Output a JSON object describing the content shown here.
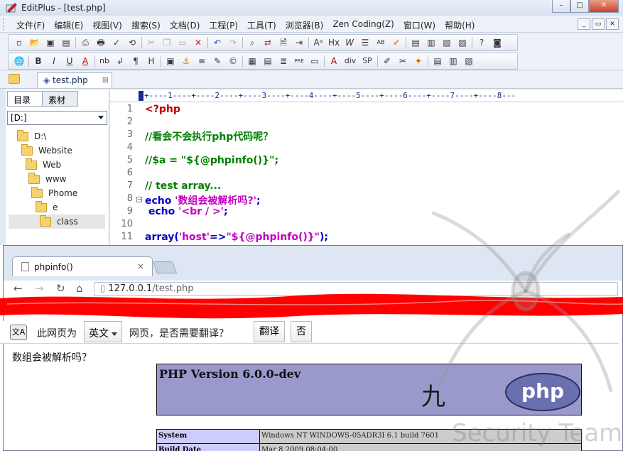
{
  "editplus": {
    "title": "EditPlus - [test.php]",
    "window_buttons": [
      "–",
      "□",
      "✕"
    ],
    "menu": [
      "文件(F)",
      "编辑(E)",
      "视图(V)",
      "搜索(S)",
      "文档(D)",
      "工程(P)",
      "工具(T)",
      "浏览器(B)",
      "Zen Coding(Z)",
      "窗口(W)",
      "帮助(H)"
    ],
    "mdi_buttons": [
      "_",
      "▭",
      "✕"
    ],
    "toolbar1": [
      "new",
      "open",
      "save",
      "save-all",
      "|",
      "print-preview",
      "print",
      "spellcheck",
      "browser-preview",
      "|",
      "cut",
      "copy",
      "paste",
      "delete",
      "|",
      "undo",
      "redo",
      "|",
      "find",
      "replace",
      "find-in-files",
      "goto",
      "|",
      "font",
      "hex",
      "word-wrap",
      "line-number",
      "column",
      "check",
      "|",
      "clip1",
      "clip2",
      "clip3",
      "clip4",
      "|",
      "help",
      "cliptext"
    ],
    "toolbar2_labels": [
      "🌐",
      "B",
      "I",
      "U",
      "A",
      "nb",
      "↲",
      "¶",
      "H",
      "▣",
      "⚓",
      "≡",
      "✎",
      "©",
      "▦",
      "▤",
      "≣",
      "PRE",
      "▭",
      "A",
      "div",
      "SP",
      "✐",
      "✂",
      "✦",
      "▤",
      "▥",
      "▧"
    ],
    "doc_tab": "test.php",
    "side_tabs": [
      "目录",
      "素材"
    ],
    "drive": "[D:]",
    "tree": [
      "D:\\",
      "Website",
      "Web",
      "www",
      "Phome",
      "e",
      "class"
    ],
    "ruler": "+----1----+----2----+----3----+----4----+----5----+----6----+----7----+----8---",
    "code_lines": [
      {
        "n": "1",
        "text": "<?php",
        "color": "#c00000"
      },
      {
        "n": "2",
        "text": "",
        "color": "#000"
      },
      {
        "n": "3",
        "text": "//看会不会执行php代码呢？",
        "color": "#008000"
      },
      {
        "n": "4",
        "text": "",
        "color": "#000"
      },
      {
        "n": "5",
        "text": "//$a = \"${@phpinfo()}\";",
        "color": "#008000"
      },
      {
        "n": "6",
        "text": "",
        "color": "#000"
      },
      {
        "n": "7",
        "text": "// test array...",
        "color": "#008000"
      },
      {
        "n": "8",
        "text": "echo '数组会被解析吗?';",
        "color": "#0000c0"
      },
      {
        "n": "9",
        "text": " echo '<br / >';",
        "color": "#0000c0"
      },
      {
        "n": "10",
        "text": "",
        "color": "#000"
      },
      {
        "n": "11",
        "text": "array('host'=>\"${@phpinfo()}\");",
        "color": "#0000c0"
      }
    ]
  },
  "browser": {
    "tab_title": "phpinfo()",
    "tab_close": "×",
    "url_host": "127.0.0.1",
    "url_path": "/test.php",
    "translate_bar": {
      "prefix": "此网页为",
      "language": "英文",
      "question": "网页，是否需要翻译？",
      "translate_button": "翻译",
      "no_button": "否"
    },
    "echo_output": "数组会被解析吗？",
    "php_version": "PHP Version 6.0.0-dev",
    "php_logo_text": "php",
    "stamp_char": "九",
    "system_table": [
      {
        "key": "System",
        "value": "Windows NT WINDOWS-05ADR3I 6.1 build 7601"
      },
      {
        "key": "Build Date",
        "value": "Mar 8 2009 08:04:00"
      }
    ]
  },
  "watermark": "Security Team"
}
